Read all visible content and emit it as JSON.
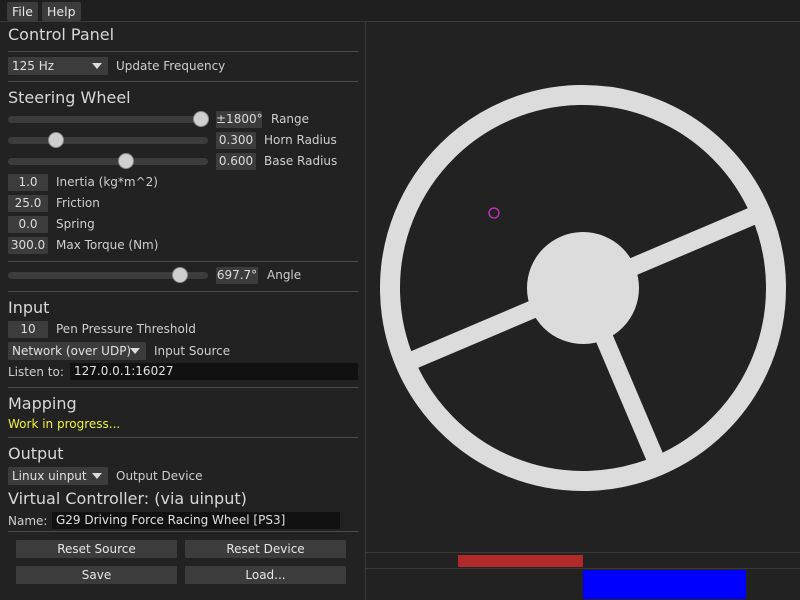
{
  "menu": {
    "file": "File",
    "help": "Help"
  },
  "panel": {
    "title": "Control Panel",
    "update_frequency": {
      "value": "125 Hz",
      "label": "Update Frequency"
    },
    "steering": {
      "heading": "Steering Wheel",
      "range": {
        "value": "±1800°",
        "label": "Range",
        "fraction": 0.965
      },
      "horn_radius": {
        "value": "0.300",
        "label": "Horn Radius",
        "fraction": 0.24
      },
      "base_radius": {
        "value": "0.600",
        "label": "Base Radius",
        "fraction": 0.59
      },
      "inertia": {
        "value": "1.0",
        "label": "Inertia (kg*m^2)"
      },
      "friction": {
        "value": "25.0",
        "label": "Friction"
      },
      "spring": {
        "value": "0.0",
        "label": "Spring"
      },
      "max_torque": {
        "value": "300.0",
        "label": "Max Torque (Nm)"
      },
      "angle": {
        "value": "697.7°",
        "label": "Angle",
        "fraction": 0.86
      }
    },
    "input": {
      "heading": "Input",
      "pen_threshold": {
        "value": "10",
        "label": "Pen Pressure Threshold"
      },
      "source": {
        "value": "Network (over UDP)",
        "label": "Input Source"
      },
      "listen": {
        "label": "Listen to:",
        "value": "127.0.0.1:16027"
      }
    },
    "mapping": {
      "heading": "Mapping",
      "status": "Work in progress..."
    },
    "output": {
      "heading": "Output",
      "device": {
        "value": "Linux uinput",
        "label": "Output Device"
      },
      "virtual_heading": "Virtual Controller: (via uinput)",
      "name": {
        "label": "Name:",
        "value": "G29 Driving Force Racing Wheel [PS3]"
      }
    },
    "buttons": {
      "reset_source": "Reset Source",
      "reset_device": "Reset Device",
      "save": "Save",
      "load": "Load..."
    }
  },
  "wheel": {
    "color": "#dcdcdc",
    "pointer_color": "#cc33cc"
  },
  "bars": {
    "red_color": "#b02a2a",
    "blue_color": "#0000ff"
  }
}
